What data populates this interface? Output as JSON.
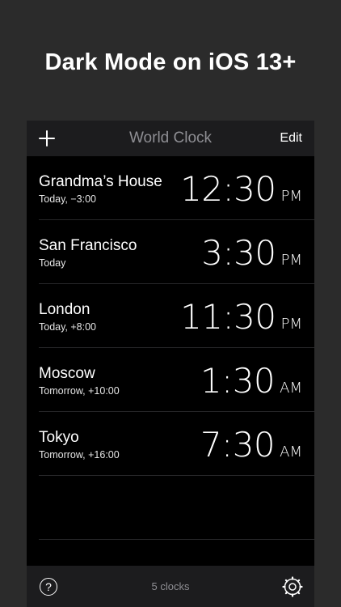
{
  "banner": {
    "title": "Dark Mode on iOS 13+"
  },
  "navbar": {
    "title": "World Clock",
    "edit_label": "Edit",
    "add_icon": "plus-icon"
  },
  "clocks": [
    {
      "city": "Grandma’s House",
      "offset": "Today, −3:00",
      "time": "12:30",
      "ampm": "PM"
    },
    {
      "city": "San Francisco",
      "offset": "Today",
      "time": "3:30",
      "ampm": "PM"
    },
    {
      "city": "London",
      "offset": "Today, +8:00",
      "time": "11:30",
      "ampm": "PM"
    },
    {
      "city": "Moscow",
      "offset": "Tomorrow, +10:00",
      "time": "1:30",
      "ampm": "AM"
    },
    {
      "city": "Tokyo",
      "offset": "Tomorrow, +16:00",
      "time": "7:30",
      "ampm": "AM"
    }
  ],
  "toolbar": {
    "count_label": "5 clocks",
    "help_icon": "help-icon",
    "settings_icon": "gear-icon"
  },
  "colors": {
    "background": "#2b2b2b",
    "bar": "#1c1c1e",
    "secondary_text": "#8e8e93"
  }
}
